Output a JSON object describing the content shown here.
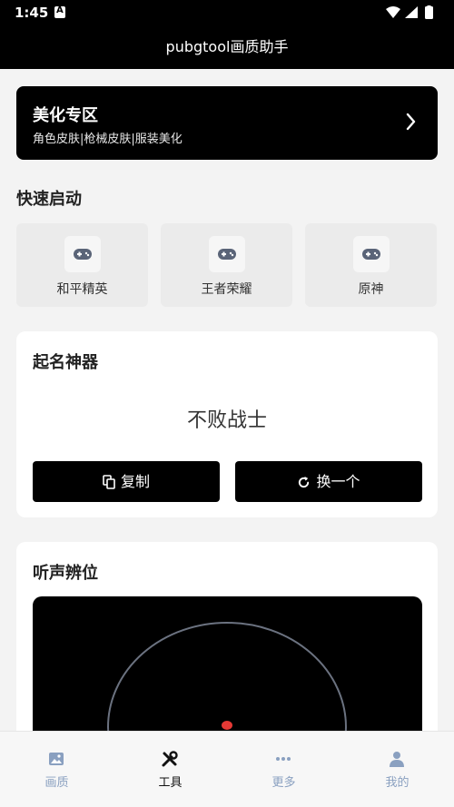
{
  "status_bar": {
    "time": "1:45"
  },
  "header": {
    "title": "pubgtool画质助手"
  },
  "beauty_banner": {
    "title": "美化专区",
    "subtitle": "角色皮肤|枪械皮肤|服装美化"
  },
  "quick_start": {
    "title": "快速启动",
    "items": [
      {
        "label": "和平精英",
        "icon": "gamepad-icon"
      },
      {
        "label": "王者荣耀",
        "icon": "gamepad-icon"
      },
      {
        "label": "原神",
        "icon": "gamepad-icon"
      }
    ]
  },
  "name_generator": {
    "title": "起名神器",
    "name": "不败战士",
    "copy_label": "复制",
    "refresh_label": "换一个"
  },
  "sound_locator": {
    "title": "听声辨位"
  },
  "tabbar": {
    "items": [
      {
        "label": "画质",
        "icon": "image-icon",
        "active": false
      },
      {
        "label": "工具",
        "icon": "tools-icon",
        "active": true
      },
      {
        "label": "更多",
        "icon": "more-icon",
        "active": false
      },
      {
        "label": "我的",
        "icon": "user-icon",
        "active": false
      }
    ]
  },
  "colors": {
    "primary": "#000000",
    "background": "#f3f3f3",
    "tab_inactive": "#8aa0c0",
    "radar_dot": "#e53935"
  }
}
